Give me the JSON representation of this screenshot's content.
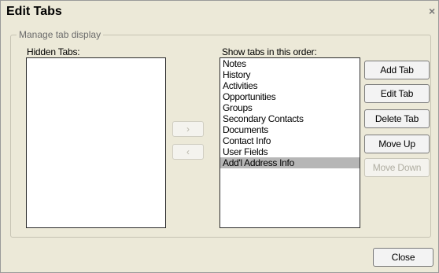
{
  "window": {
    "title": "Edit Tabs",
    "close_glyph": "×"
  },
  "group": {
    "label": "Manage tab display"
  },
  "hidden_tabs": {
    "label": "Hidden Tabs:",
    "items": []
  },
  "shown_tabs": {
    "label": "Show tabs in this order:",
    "items": [
      "Notes",
      "History",
      "Activities",
      "Opportunities",
      "Groups",
      "Secondary Contacts",
      "Documents",
      "Contact Info",
      "User Fields",
      "Add'l Address Info"
    ],
    "selected_index": 9
  },
  "move_buttons": {
    "move_right": "›",
    "move_left": "‹"
  },
  "actions": {
    "add_tab": "Add Tab",
    "edit_tab": "Edit Tab",
    "delete_tab": "Delete Tab",
    "move_up": "Move Up",
    "move_down": "Move Down"
  },
  "footer": {
    "close": "Close"
  }
}
